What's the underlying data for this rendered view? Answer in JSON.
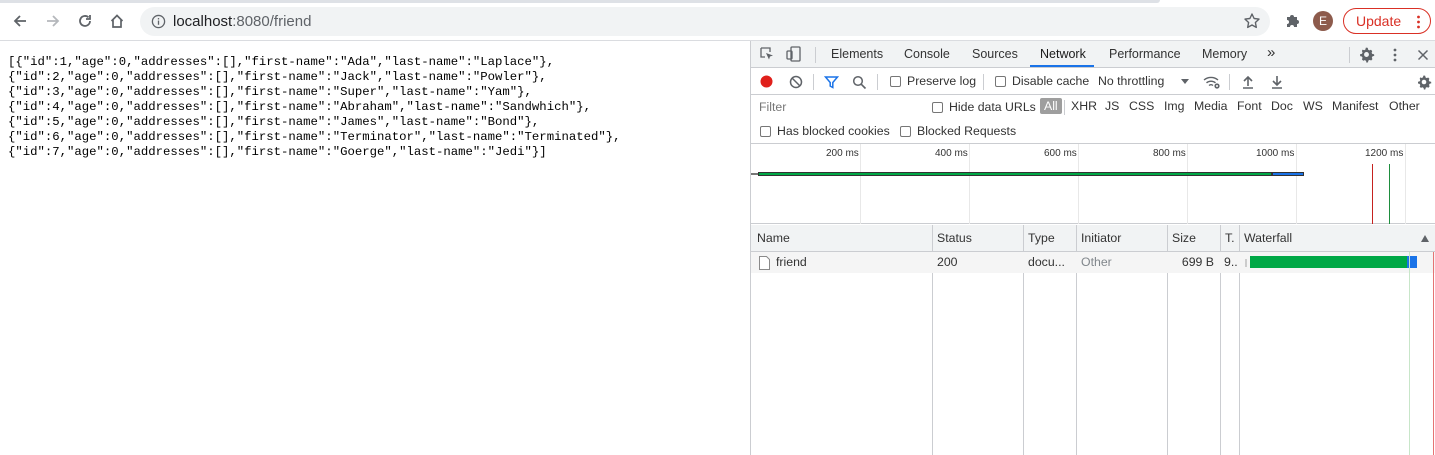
{
  "browser": {
    "url_host": "localhost",
    "url_path": ":8080/friend",
    "avatar_letter": "E",
    "update_label": "Update",
    "icons": [
      "back-icon",
      "forward-icon",
      "reload-icon",
      "home-icon",
      "info-icon",
      "star-icon",
      "puzzle-icon",
      "kebab-icon"
    ],
    "accent_color": "#d93025"
  },
  "page": {
    "json_lines": [
      "[{\"id\":1,\"age\":0,\"addresses\":[],\"first-name\":\"Ada\",\"last-name\":\"Laplace\"},",
      "{\"id\":2,\"age\":0,\"addresses\":[],\"first-name\":\"Jack\",\"last-name\":\"Powler\"},",
      "{\"id\":3,\"age\":0,\"addresses\":[],\"first-name\":\"Super\",\"last-name\":\"Yam\"},",
      "{\"id\":4,\"age\":0,\"addresses\":[],\"first-name\":\"Abraham\",\"last-name\":\"Sandwhich\"},",
      "{\"id\":5,\"age\":0,\"addresses\":[],\"first-name\":\"James\",\"last-name\":\"Bond\"},",
      "{\"id\":6,\"age\":0,\"addresses\":[],\"first-name\":\"Terminator\",\"last-name\":\"Terminated\"},",
      "{\"id\":7,\"age\":0,\"addresses\":[],\"first-name\":\"Goerge\",\"last-name\":\"Jedi\"}]"
    ]
  },
  "devtools": {
    "tabs": [
      "Elements",
      "Console",
      "Sources",
      "Network",
      "Performance",
      "Memory",
      "»"
    ],
    "active_tab": "Network",
    "toolbar": {
      "preserve_log": "Preserve log",
      "disable_cache": "Disable cache",
      "throttling": "No throttling"
    },
    "filter": {
      "placeholder": "Filter",
      "hide_data_urls": "Hide data URLs",
      "types": [
        "All",
        "XHR",
        "JS",
        "CSS",
        "Img",
        "Media",
        "Font",
        "Doc",
        "WS",
        "Manifest",
        "Other"
      ],
      "has_blocked_cookies": "Has blocked cookies",
      "blocked_requests": "Blocked Requests"
    },
    "overview": {
      "tick_labels": [
        "200 ms",
        "400 ms",
        "600 ms",
        "800 ms",
        "1000 ms",
        "1200 ms"
      ]
    },
    "table": {
      "headers": [
        "Name",
        "Status",
        "Type",
        "Initiator",
        "Size",
        "T.",
        "Waterfall"
      ],
      "rows": [
        {
          "name": "friend",
          "status": "200",
          "type": "docu...",
          "initiator": "Other",
          "size": "699 B",
          "time": "9.."
        }
      ]
    },
    "colors": {
      "record": "#e0201b",
      "filter_active": "#1a73e8",
      "waterfall_wait": "#00a846",
      "waterfall_download": "#1a73e8",
      "dom_loaded": "#1a73e8",
      "load_event": "#c5221f"
    }
  }
}
